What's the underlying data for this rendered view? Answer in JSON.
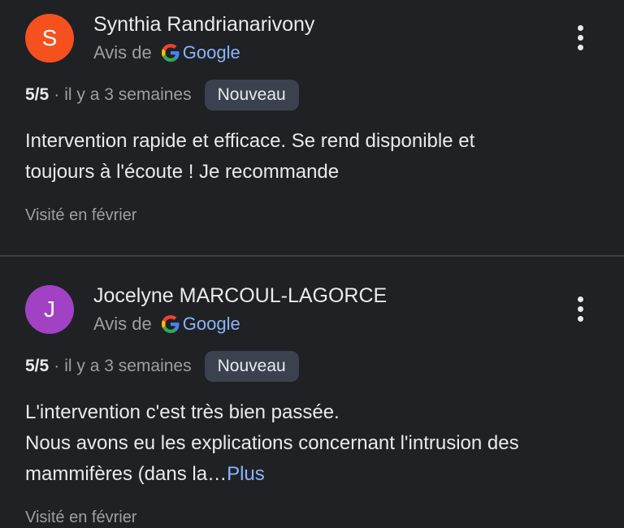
{
  "reviews": [
    {
      "initial": "S",
      "avatar_color": "#f4511e",
      "name": "Synthia Randrianarivony",
      "source_prefix": "Avis de",
      "source_name": "Google",
      "rating": "5/5",
      "separator": "·",
      "time": "il y a 3 semaines",
      "badge": "Nouveau",
      "text_lines": [
        "Intervention rapide et efficace. Se rend disponible et",
        "toujours à l'écoute ! Je recommande"
      ],
      "visited": "Visité en février"
    },
    {
      "initial": "J",
      "avatar_color": "#a142c4",
      "name": "Jocelyne MARCOUL-LAGORCE",
      "source_prefix": "Avis de",
      "source_name": "Google",
      "rating": "5/5",
      "separator": "·",
      "time": "il y a 3 semaines",
      "badge": "Nouveau",
      "text_lines": [
        "L'intervention c'est très bien passée.",
        "Nous avons eu les explications concernant l'intrusion des",
        "mammifères (dans la…"
      ],
      "more": "Plus",
      "visited": "Visité en février"
    }
  ],
  "colors": {
    "background": "#202124",
    "link": "#8ab4f8",
    "badge_bg": "#3c4150"
  }
}
